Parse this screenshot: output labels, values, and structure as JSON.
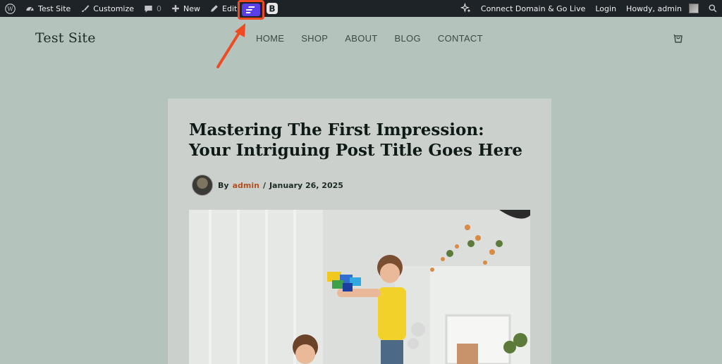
{
  "adminbar": {
    "site_name": "Test Site",
    "customize": "Customize",
    "comments_count": "0",
    "new_label": "New",
    "edit_post": "Edit Post",
    "connect": "Connect Domain & Go Live",
    "login": "Login",
    "howdy": "Howdy, admin",
    "icons": [
      "wordpress-logo-icon",
      "dashboard-icon",
      "brush-icon",
      "comment-icon",
      "plus-icon",
      "pencil-icon",
      "plugin-icon",
      "b-logo-icon",
      "sparkle-icon",
      "search-icon"
    ],
    "highlight_color": "#ef4b23"
  },
  "header": {
    "site_title": "Test Site",
    "nav": [
      "HOME",
      "SHOP",
      "ABOUT",
      "BLOG",
      "CONTACT"
    ]
  },
  "post": {
    "title": "Mastering The First Impression: Your Intriguing Post Title Goes Here",
    "by": "By",
    "author": "admin",
    "date": "January 26, 2025"
  },
  "colors": {
    "accent": "#b3501f",
    "plugin_purple": "#5b3fe6",
    "page_bg": "#b5c3bd"
  }
}
